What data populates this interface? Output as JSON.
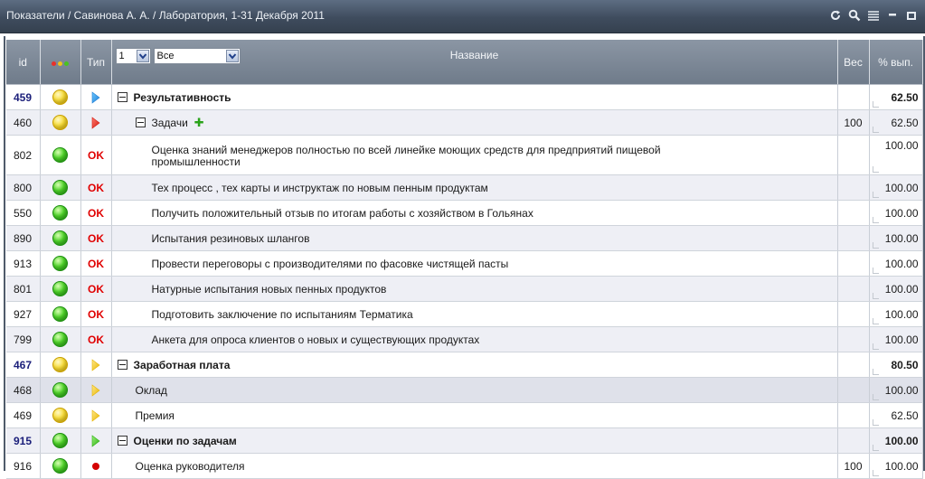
{
  "window": {
    "title": "Показатели / Савинова А. А. / Лаборатория, 1-31 Декабря 2011",
    "icons": [
      "refresh-icon",
      "search-icon",
      "list-icon",
      "minimize-icon",
      "maximize-icon"
    ]
  },
  "table": {
    "headers": {
      "id": "id",
      "type": "Тип",
      "level_select": "1",
      "filter_select": "Все",
      "name": "Название",
      "weight": "Вес",
      "percent": "% вып."
    },
    "rows": [
      {
        "id": "459",
        "status": "yellow",
        "type": "arrow-blue",
        "name": "Результативность",
        "level": 0,
        "expander": true,
        "bold": true,
        "weight": "",
        "percent": "62.50"
      },
      {
        "id": "460",
        "status": "yellow",
        "type": "arrow-red",
        "name": "Задачи",
        "level": 1,
        "expander": true,
        "add": true,
        "bold": false,
        "weight": "100",
        "percent": "62.50"
      },
      {
        "id": "802",
        "status": "green",
        "type": "ok",
        "type_text": "OK",
        "name": "Оценка знаний менеджеров полностью по всей линейке моющих средств для предприятий пищевой промышленности",
        "level": 2,
        "bold": false,
        "weight": "",
        "percent": "100.00",
        "tall": true
      },
      {
        "id": "800",
        "status": "green",
        "type": "ok",
        "type_text": "OK",
        "name": "Тех процесс , тех карты и инструктаж по новым пенным продуктам",
        "level": 2,
        "bold": false,
        "weight": "",
        "percent": "100.00"
      },
      {
        "id": "550",
        "status": "green",
        "type": "ok",
        "type_text": "OK",
        "name": "Получить положительный отзыв по итогам работы с хозяйством в Гольянах",
        "level": 2,
        "bold": false,
        "weight": "",
        "percent": "100.00"
      },
      {
        "id": "890",
        "status": "green",
        "type": "ok",
        "type_text": "OK",
        "name": "Испытания резиновых шлангов",
        "level": 2,
        "bold": false,
        "weight": "",
        "percent": "100.00"
      },
      {
        "id": "913",
        "status": "green",
        "type": "ok",
        "type_text": "OK",
        "name": "Провести переговоры с производителями по фасовке чистящей пасты",
        "level": 2,
        "bold": false,
        "weight": "",
        "percent": "100.00"
      },
      {
        "id": "801",
        "status": "green",
        "type": "ok",
        "type_text": "OK",
        "name": "Натурные испытания новых пенных продуктов",
        "level": 2,
        "bold": false,
        "weight": "",
        "percent": "100.00"
      },
      {
        "id": "927",
        "status": "green",
        "type": "ok",
        "type_text": "OK",
        "name": "Подготовить заключение по испытаниям Терматика",
        "level": 2,
        "bold": false,
        "weight": "",
        "percent": "100.00"
      },
      {
        "id": "799",
        "status": "green",
        "type": "ok",
        "type_text": "OK",
        "name": "Анкета для опроса клиентов о новых и существующих продуктах",
        "level": 2,
        "bold": false,
        "weight": "",
        "percent": "100.00"
      },
      {
        "id": "467",
        "status": "yellow",
        "type": "arrow-yellow",
        "name": "Заработная плата",
        "level": 0,
        "expander": true,
        "bold": true,
        "weight": "",
        "percent": "80.50"
      },
      {
        "id": "468",
        "status": "green",
        "type": "arrow-yellow",
        "name": "Оклад",
        "level": 1,
        "bold": false,
        "weight": "",
        "percent": "100.00",
        "highlight": true
      },
      {
        "id": "469",
        "status": "yellow",
        "type": "arrow-yellow",
        "name": "Премия",
        "level": 1,
        "bold": false,
        "weight": "",
        "percent": "62.50"
      },
      {
        "id": "915",
        "status": "green",
        "type": "arrow-green",
        "name": "Оценки по задачам",
        "level": 0,
        "expander": true,
        "bold": true,
        "weight": "",
        "percent": "100.00"
      },
      {
        "id": "916",
        "status": "green",
        "type": "dot-red",
        "name": "Оценка руководителя",
        "level": 1,
        "bold": false,
        "weight": "100",
        "percent": "100.00"
      }
    ]
  },
  "colors": {
    "titlebar": "#3f4c5e",
    "header": "#7a8593",
    "row_alt": "#eeeff5",
    "ok": "#e00000",
    "id_bold": "#1b1f7a"
  }
}
